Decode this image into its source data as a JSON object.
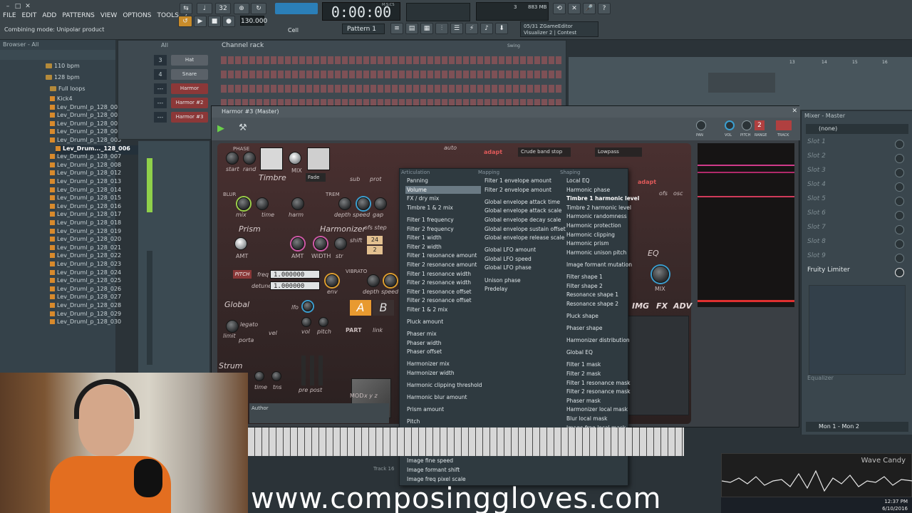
{
  "menubar": [
    "FILE",
    "EDIT",
    "ADD",
    "PATTERNS",
    "VIEW",
    "OPTIONS",
    "TOOLS",
    "?"
  ],
  "hint": "Combining mode: Unipolar product",
  "transport": {
    "time": "0:00:00",
    "tempo": "130.000",
    "pattern": "Pattern 1",
    "snap": "Cell",
    "time_label": "M:S:CS",
    "memory": "883 MB",
    "cpu": "3"
  },
  "hint_panel": {
    "line1": "05/31 ZGameEditor",
    "line2": "Visualizer 2 | Contest"
  },
  "browser": {
    "title": "Browser - All",
    "items": [
      {
        "label": "110 bpm",
        "type": "folder"
      },
      {
        "label": "128 bpm",
        "type": "folder"
      },
      {
        "label": "Full loops",
        "type": "folder"
      },
      {
        "label": "Kick4",
        "type": "file"
      },
      {
        "label": "Lev_Druml_p_128_001",
        "type": "file"
      },
      {
        "label": "Lev_Druml_p_128_002",
        "type": "file"
      },
      {
        "label": "Lev_Druml_p_128_003",
        "type": "file"
      },
      {
        "label": "Lev_Druml_p_128_004",
        "type": "file"
      },
      {
        "label": "Lev_Druml_p_128_005",
        "type": "file"
      },
      {
        "label": "Lev_Drum..._128_006",
        "type": "file",
        "selected": true
      },
      {
        "label": "Lev_Druml_p_128_007",
        "type": "file"
      },
      {
        "label": "Lev_Druml_p_128_008",
        "type": "file"
      },
      {
        "label": "Lev_Druml_p_128_012",
        "type": "file"
      },
      {
        "label": "Lev_Druml_p_128_013",
        "type": "file"
      },
      {
        "label": "Lev_Druml_p_128_014",
        "type": "file"
      },
      {
        "label": "Lev_Druml_p_128_015",
        "type": "file"
      },
      {
        "label": "Lev_Druml_p_128_016",
        "type": "file"
      },
      {
        "label": "Lev_Druml_p_128_017",
        "type": "file"
      },
      {
        "label": "Lev_Druml_p_128_018",
        "type": "file"
      },
      {
        "label": "Lev_Druml_p_128_019",
        "type": "file"
      },
      {
        "label": "Lev_Druml_p_128_020",
        "type": "file"
      },
      {
        "label": "Lev_Druml_p_128_021",
        "type": "file"
      },
      {
        "label": "Lev_Druml_p_128_022",
        "type": "file"
      },
      {
        "label": "Lev_Druml_p_128_023",
        "type": "file"
      },
      {
        "label": "Lev_Druml_p_128_024",
        "type": "file"
      },
      {
        "label": "Lev_Druml_p_128_025",
        "type": "file"
      },
      {
        "label": "Lev_Druml_p_128_026",
        "type": "file"
      },
      {
        "label": "Lev_Druml_p_128_027",
        "type": "file"
      },
      {
        "label": "Lev_Druml_p_128_028",
        "type": "file"
      },
      {
        "label": "Lev_Druml_p_128_029",
        "type": "file"
      },
      {
        "label": "Lev_Druml_p_128_030",
        "type": "file"
      }
    ]
  },
  "channel_rack": {
    "title": "Channel rack",
    "filter": "All",
    "swing": "Swing",
    "channels": [
      {
        "num": "3",
        "name": "Hat",
        "accent": false
      },
      {
        "num": "4",
        "name": "Snare",
        "accent": false
      },
      {
        "num": "---",
        "name": "Harmor",
        "accent": true
      },
      {
        "num": "---",
        "name": "Harmor #2",
        "accent": true
      },
      {
        "num": "---",
        "name": "Harmor #3",
        "accent": true
      }
    ]
  },
  "harmor": {
    "title": "Harmor #3 (Master)",
    "channel_num": "2",
    "labels": {
      "phase": "PHASE",
      "start": "start",
      "rand": "rand",
      "timbre": "Timbre",
      "mix": "MIX",
      "fade": "Fade",
      "sub": "sub",
      "prot": "prot",
      "auto": "auto",
      "blur": "BLUR",
      "blur_mix": "mix",
      "blur_time": "time",
      "harm": "harm",
      "trem": "TREM",
      "depth": "depth",
      "speed": "speed",
      "gap": "gap",
      "prism": "Prism",
      "harmonizer": "Harmonizer",
      "ofs_step": "ofs step",
      "shift": "shift",
      "amt": "AMT",
      "width": "WIDTH",
      "str": "str",
      "pitch": "PITCH",
      "freq": "freq",
      "detune": "detune",
      "env": "env",
      "vibrato": "VIBRATO",
      "vib_depth": "depth",
      "vib_speed": "speed",
      "global": "Global",
      "lfo": "lfo",
      "legato": "legato",
      "porta": "porta",
      "limit": "limit",
      "vel": "vel",
      "vol": "vol",
      "pitch_small": "pitch",
      "part": "PART",
      "link": "link",
      "strum": "Strum",
      "time": "time",
      "tns": "tns",
      "pre_post": "pre post",
      "a": "A",
      "b": "B",
      "mod": "MOD",
      "xyz": "x y z",
      "author": "Author",
      "filter_type": "Crude band stop",
      "filter_type2": "Lowpass",
      "adapt": "adapt",
      "eq": "EQ",
      "img": "IMG",
      "fx": "FX",
      "adv": "ADV",
      "ofs": "ofs",
      "osc": "osc",
      "freq_val": "1.000000",
      "detune_val": "1.000000",
      "shift_val": "24",
      "gap_val": "2",
      "track": "Track 16"
    }
  },
  "context_menu": {
    "col1_header": "Articulation",
    "col2_header": "Mapping",
    "col3_header": "Shaping",
    "col1": [
      "Panning",
      "Volume",
      "FX / dry mix",
      "Timbre 1 & 2 mix",
      "",
      "Filter 1 frequency",
      "Filter 2 frequency",
      "Filter 1 width",
      "Filter 2 width",
      "Filter 1 resonance amount",
      "Filter 2 resonance amount",
      "Filter 1 resonance width",
      "Filter 2 resonance width",
      "Filter 1 resonance offset",
      "Filter 2 resonance offset",
      "Filter 1 & 2 mix",
      "",
      "Pluck amount",
      "",
      "Phaser mix",
      "Phaser width",
      "Phaser offset",
      "",
      "Harmonizer mix",
      "Harmonizer width",
      "",
      "Harmonic clipping threshold",
      "",
      "Harmonic blur amount",
      "",
      "Prism amount",
      "",
      "Pitch",
      "Pitch vibrato depth",
      "Unison pitch thickness",
      "",
      "Image time offset",
      "Image fine speed",
      "Image formant shift",
      "Image freq pixel scale"
    ],
    "col2": [
      "Filter 1 envelope amount",
      "Filter 2 envelope amount",
      "",
      "Global envelope attack time",
      "Global envelope attack scale",
      "Global envelope decay scale",
      "Global envelope sustain offset",
      "Global envelope release scale",
      "",
      "Global LFO amount",
      "Global LFO speed",
      "Global LFO phase",
      "",
      "Unison phase",
      "Predelay"
    ],
    "col3": [
      "Local EQ",
      "Harmonic phase",
      "Timbre 1 harmonic level",
      "Timbre 2 harmonic level",
      "Harmonic randomness",
      "Harmonic protection",
      "Harmonic clipping",
      "Harmonic prism",
      "Harmonic unison pitch",
      "",
      "Image formant mutation",
      "",
      "Filter shape 1",
      "Filter shape 2",
      "Resonance shape 1",
      "Resonance shape 2",
      "",
      "Pluck shape",
      "",
      "Phaser shape",
      "",
      "Harmonizer distribution",
      "",
      "Global EQ",
      "",
      "Filter 1 mask",
      "Filter 2 mask",
      "Filter 1 resonance mask",
      "Filter 2 resonance mask",
      "Phaser mask",
      "Harmonizer local mask",
      "Blur local mask",
      "Image freq local mask",
      "",
      "Image selected column"
    ],
    "highlighted": "Volume",
    "bold": "Timbre 1 harmonic level"
  },
  "mixer": {
    "title": "Mixer - Master",
    "input": "(none)",
    "slots": [
      "Slot 1",
      "Slot 2",
      "Slot 3",
      "Slot 4",
      "Slot 5",
      "Slot 6",
      "Slot 7",
      "Slot 8",
      "Slot 9"
    ],
    "effect": "Fruity Limiter",
    "eq_label": "Equalizer",
    "output": "Mon 1 - Mon 2",
    "pan": "PAN",
    "vol": "VOL",
    "pitch": "PITCH",
    "range": "RANGE",
    "track": "TRACK",
    "track_num": "2"
  },
  "playlist_ruler": [
    "13",
    "14",
    "15",
    "16"
  ],
  "wave_candy": "Wave Candy",
  "clock": {
    "time": "12:37 PM",
    "date": "6/10/2016"
  },
  "watermark": "www.composinggloves.com",
  "colors": {
    "accent_red": "#b04040",
    "accent_blue": "#3b9fd0",
    "orange": "#e36e20"
  }
}
